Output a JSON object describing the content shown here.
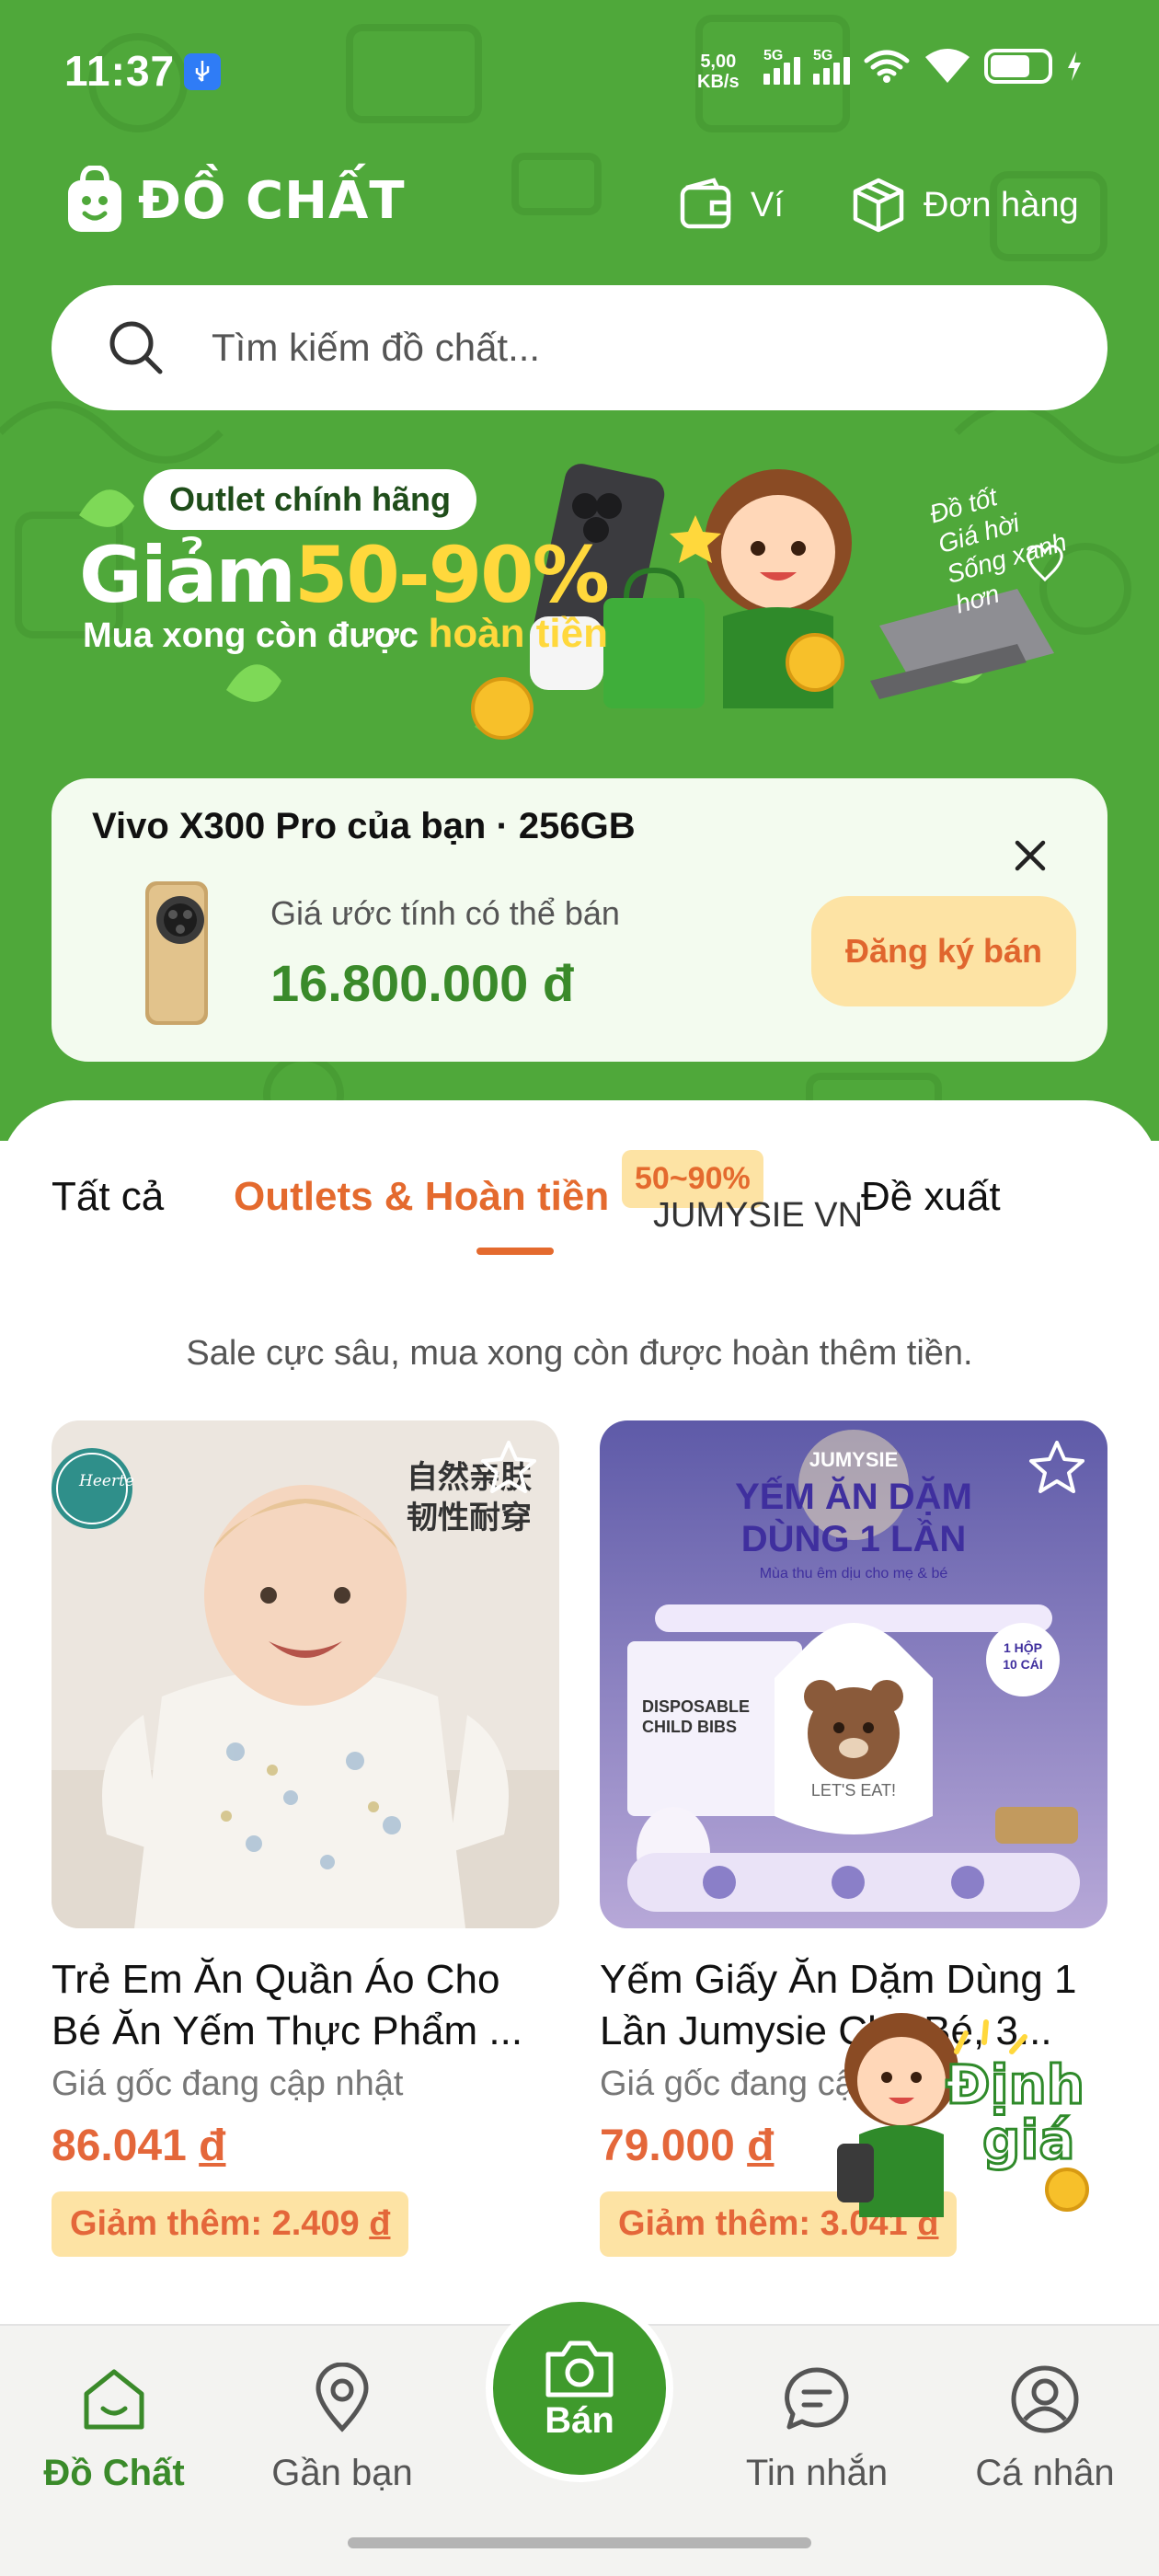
{
  "status_bar": {
    "time": "11:37",
    "net_speed_value": "5,00",
    "net_speed_unit": "KB/s",
    "sim1_label": "5G",
    "sim2_label": "5G"
  },
  "header": {
    "logo_text": "ĐỒ CHẤT",
    "wallet_label": "Ví",
    "orders_label": "Đơn hàng"
  },
  "search": {
    "placeholder": "Tìm kiếm đồ chất..."
  },
  "banner": {
    "badge": "Outlet chính hãng",
    "headline_prefix": "Giảm",
    "headline_percent": "50-90%",
    "subline_prefix": "Mua xong còn được",
    "subline_highlight": "hoàn tiền",
    "slogan_1": "Đồ tốt",
    "slogan_2": "Giá hời",
    "slogan_3": "Sống xanh hơn"
  },
  "sell_card": {
    "title": "Vivo X300 Pro của bạn · 256GB",
    "estimate_label": "Giá ước tính có thể bán",
    "estimate_price": "16.800.000 đ",
    "button_label": "Đăng ký bán"
  },
  "tabs": {
    "all": "Tất cả",
    "outlets": "Outlets & Hoàn tiền",
    "outlets_badge": "50~90%",
    "suggest": "Đề xuất"
  },
  "tagline": "Sale cực sâu, mua xong còn được hoàn thêm tiền.",
  "products": [
    {
      "title": "Trẻ Em Ăn Quần Áo Cho Bé Ăn Yếm Thực Phẩm ...",
      "original_price": "Giá gốc đang cập nhật",
      "price_value": "86.041",
      "currency": "đ",
      "discount": "Giảm thêm: 2.409 ",
      "brand_logo": "Heerte",
      "image_text_1": "自然亲肤",
      "image_text_2": "韧性耐穿"
    },
    {
      "title": "Yếm Giấy Ăn Dặm Dùng 1 Lần Jumysie Cho Bé, 3...",
      "original_price": "Giá gốc đang cập nhật",
      "price_value": "79.000",
      "currency": "đ",
      "discount": "Giảm thêm: 3.041 ",
      "brand_logo": "JUMYSIE",
      "image_title_1": "YẾM ĂN DẶM",
      "image_title_2": "DÙNG 1 LẦN",
      "image_sub": "Mùa thu êm dịu cho mẹ & bé",
      "box_text_1": "DISPOSABLE",
      "box_text_2": "CHILD BIBS",
      "bib_text": "LET'S EAT!",
      "count_badge_1": "1 HỘP",
      "count_badge_2": "10 CÁI"
    }
  ],
  "seller_peek": "JUMYSIE VN",
  "floating_badge": {
    "line1": "Định",
    "line2": "giá"
  },
  "bottom_nav": {
    "home": "Đồ Chất",
    "nearby": "Gần bạn",
    "sell": "Bán",
    "messages": "Tin nhắn",
    "profile": "Cá nhân"
  },
  "colors": {
    "brand_green": "#4fa83a",
    "accent_orange": "#e4673a",
    "badge_yellow": "#fde3a4"
  }
}
